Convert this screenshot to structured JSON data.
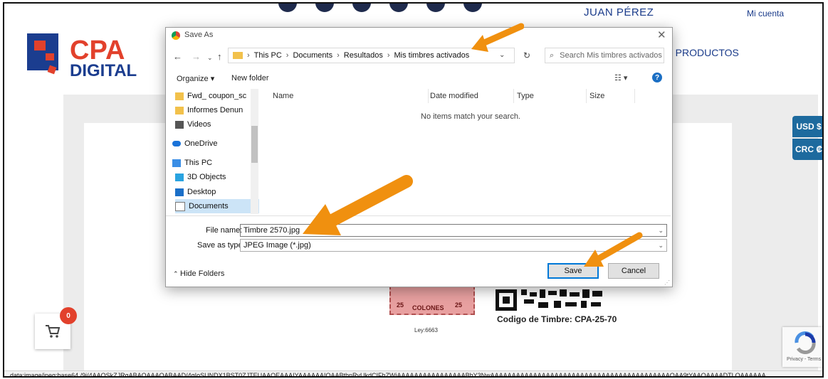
{
  "header": {
    "user_name": "JUAN PÉREZ",
    "my_account": "Mi cuenta",
    "products": "0 PRODUCTOS",
    "logo_text_top": "CPA",
    "logo_text_bottom": "DIGITAL"
  },
  "currency": {
    "usd": "USD $",
    "crc": "CRC ₡"
  },
  "stamp": {
    "label": "COLONES",
    "value": "25",
    "law": "Ley:6663",
    "code": "Codigo de Timbre: CPA-25-70"
  },
  "cart": {
    "count": "0"
  },
  "recaptcha": {
    "text": "Privacy - Terms"
  },
  "status_bar": "data:image/jpeg;base64,/9j/4AAQSkZJRgABAQAAAQABAAD/4gIoSUNDX1BST0ZJTEUAAQEAAAIYAAAAAAIQAABtbnRyUkdCIFhZWiAAAAAAAAAAAAAAAABhY3NwAAAAAAAAAAAAAAAAAAAAAAAAAAAAAAAAAAAAAAAAAAQAA9tYAAQAAAADTLQAAAAAA...",
  "dialog": {
    "title": "Save As",
    "path": [
      "This PC",
      "Documents",
      "Resultados",
      "Mis timbres activados"
    ],
    "search_placeholder": "Search Mis timbres activados",
    "organize": "Organize ▾",
    "new_folder": "New folder",
    "tree": [
      {
        "label": "Fwd_ coupon_sc",
        "icon": "folder-icon"
      },
      {
        "label": "Informes Denun",
        "icon": "folder-icon"
      },
      {
        "label": "Videos",
        "icon": "videos-icon"
      },
      {
        "label": "OneDrive",
        "icon": "cloud-icon"
      },
      {
        "label": "This PC",
        "icon": "computer-icon"
      },
      {
        "label": "3D Objects",
        "icon": "cube-icon"
      },
      {
        "label": "Desktop",
        "icon": "desktop-icon"
      },
      {
        "label": "Documents",
        "icon": "documents-icon"
      }
    ],
    "columns": [
      "Name",
      "Date modified",
      "Type",
      "Size"
    ],
    "empty_message": "No items match your search.",
    "file_name_label": "File name:",
    "file_name_value": "Timbre 2570.jpg",
    "save_type_label": "Save as type:",
    "save_type_value": "JPEG Image (*.jpg)",
    "hide_folders": "Hide Folders",
    "save_button": "Save",
    "cancel_button": "Cancel"
  }
}
